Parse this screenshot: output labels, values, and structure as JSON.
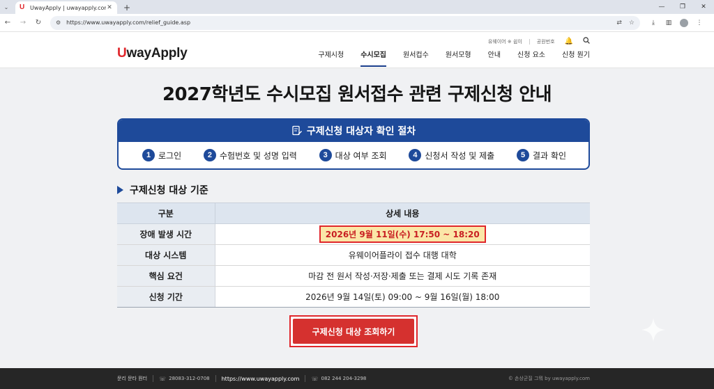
{
  "browser": {
    "tab_title": "UwayApply | uwayapply.com",
    "favicon": "U",
    "url": "https://www.uwayapply.com/relief_guide.asp"
  },
  "header": {
    "logo_u": "U",
    "logo_rest": "wayApply",
    "utility": [
      "유웨이어 ※ 쉽이",
      "공원번호"
    ],
    "nav": [
      "구제시청",
      "수시모집",
      "원서컵수",
      "원서모형",
      "안내",
      "신청 요소",
      "신청 뭔기"
    ],
    "active_nav_index": 1
  },
  "main": {
    "title": "2027학년도 수시모집 원서접수 관련 구제신청 안내",
    "process": {
      "heading": "구제신청 대상자 확인 절차",
      "steps": [
        {
          "num": "1",
          "label": "로그인"
        },
        {
          "num": "2",
          "label": "수험번호 및 성명 입력"
        },
        {
          "num": "3",
          "label": "대상 여부 조회"
        },
        {
          "num": "4",
          "label": "신청서 작성 및 제출"
        },
        {
          "num": "5",
          "label": "결과 확인"
        }
      ]
    },
    "section_title": "구제신청 대상 기준",
    "table": {
      "headers": [
        "구분",
        "상세 내용"
      ],
      "rows": [
        {
          "label": "장애 발생 시간",
          "value": "2026년 9월 11일(수) 17:50 ~ 18:20"
        },
        {
          "label": "대상 시스템",
          "value": "유웨이어플라이 접수 대행 대학"
        },
        {
          "label": "핵심 요건",
          "value": "마감 전 원서 작성·저장·제출 또는 결제 시도 기록 존재"
        },
        {
          "label": "신청 기간",
          "value": "2026년 9월 14일(토) 09:00 ~ 9월 16일(월) 18:00"
        }
      ]
    },
    "cta_label": "구제신청 대상 조회하기"
  },
  "footer": {
    "center": "문리 문타 뭔터",
    "phone1": "28083-312-0708",
    "url": "https://www.uwayapply.com",
    "phone2": "082 244 204-3298",
    "copyright": "© 손상군질 그뭐 by uwayapply.com"
  },
  "colors": {
    "brand_blue": "#1e4a9a",
    "brand_red": "#e0262b",
    "highlight_bg": "#fbe7a8"
  }
}
